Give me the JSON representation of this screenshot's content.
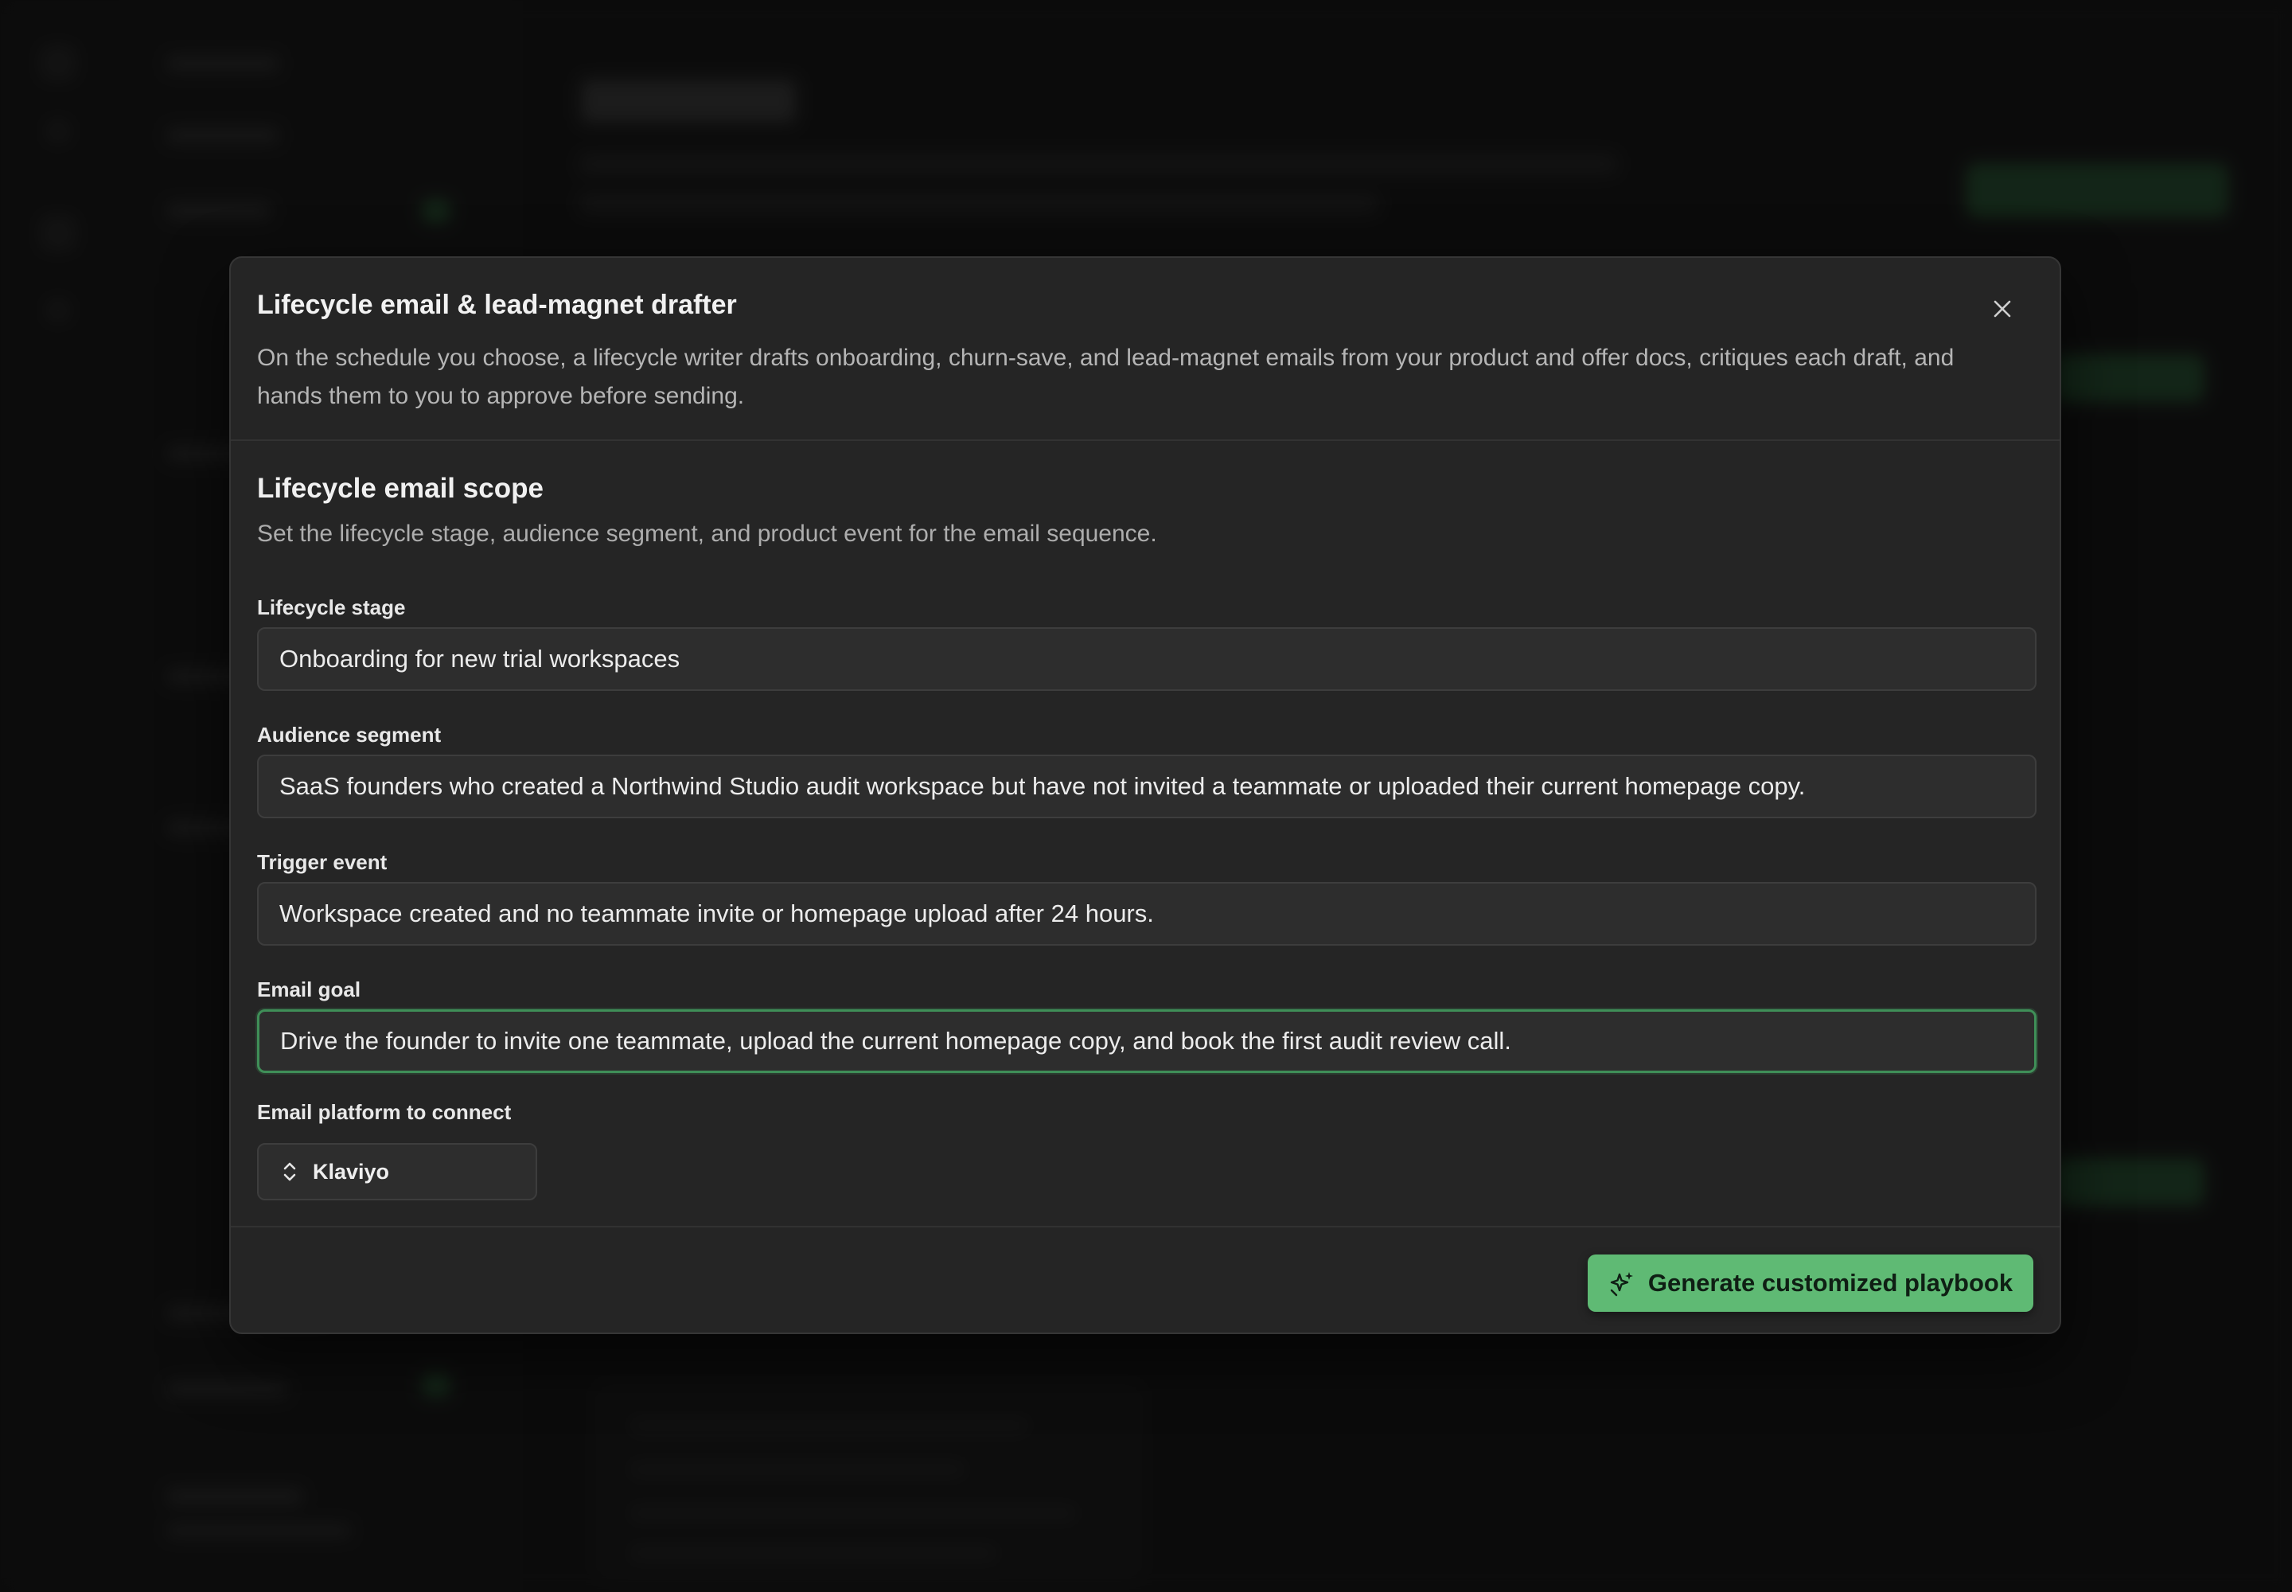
{
  "modal": {
    "title": "Lifecycle email & lead-magnet drafter",
    "description": "On the schedule you choose, a lifecycle writer drafts onboarding, churn-save, and lead-magnet emails from your product and offer docs, critiques each draft, and hands them to you to approve before sending.",
    "close_icon": "close-icon"
  },
  "section": {
    "title": "Lifecycle email scope",
    "description": "Set the lifecycle stage, audience segment, and product event for the email sequence."
  },
  "fields": {
    "lifecycle_stage": {
      "label": "Lifecycle stage",
      "value": "Onboarding for new trial workspaces"
    },
    "audience_segment": {
      "label": "Audience segment",
      "value": "SaaS founders who created a Northwind Studio audit workspace but have not invited a teammate or uploaded their current homepage copy."
    },
    "trigger_event": {
      "label": "Trigger event",
      "value": "Workspace created and no teammate invite or homepage upload after 24 hours."
    },
    "email_goal": {
      "label": "Email goal",
      "value": "Drive the founder to invite one teammate, upload the current homepage copy, and book the first audit review call."
    },
    "email_platform": {
      "label": "Email platform to connect",
      "value": "Klaviyo",
      "icon": "chevrons-up-down-icon"
    }
  },
  "footer": {
    "generate_label": "Generate customized playbook",
    "generate_icon": "sparkles-icon"
  },
  "colors": {
    "accent": "#5fba74",
    "focus_ring": "#3f8f58",
    "modal_bg": "#252525",
    "page_bg": "#121212"
  }
}
